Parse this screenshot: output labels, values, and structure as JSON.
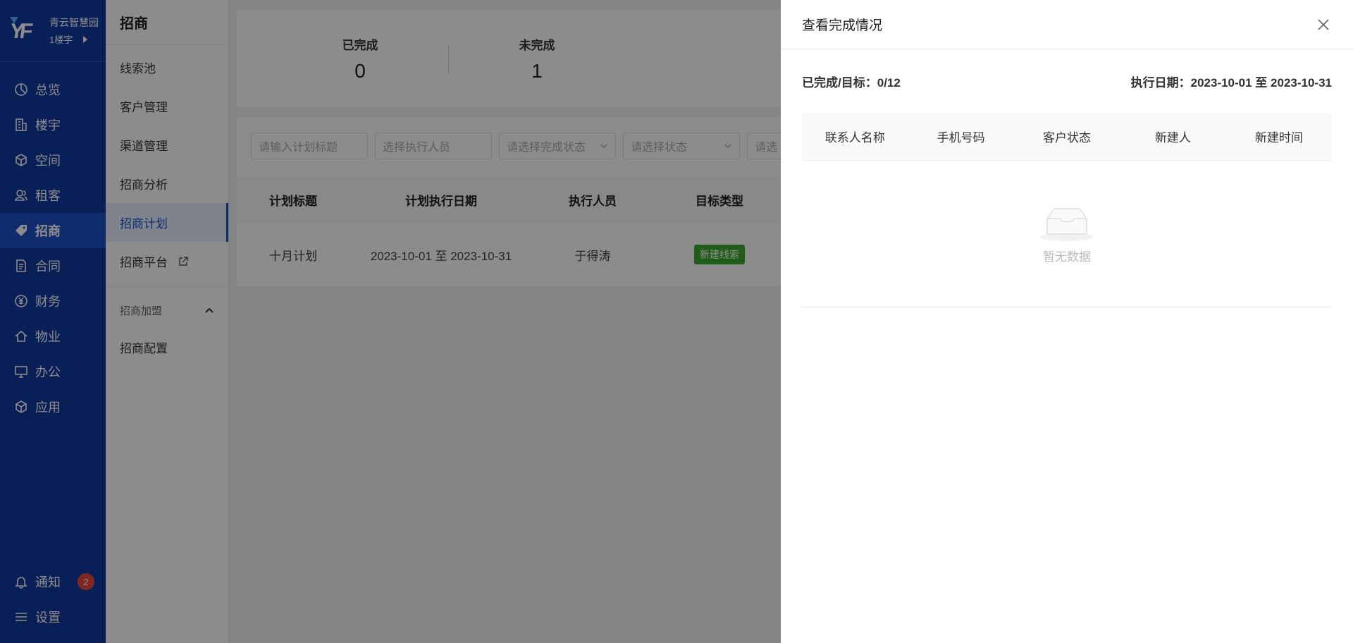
{
  "brand": {
    "name": "青云智慧园",
    "building": "1楼宇"
  },
  "nav": {
    "items": [
      {
        "label": "总览",
        "icon": "pie-chart-icon"
      },
      {
        "label": "楼宇",
        "icon": "building-icon"
      },
      {
        "label": "空间",
        "icon": "cube-icon"
      },
      {
        "label": "租客",
        "icon": "users-icon"
      },
      {
        "label": "招商",
        "icon": "tag-icon"
      },
      {
        "label": "合同",
        "icon": "document-icon"
      },
      {
        "label": "财务",
        "icon": "yen-circle-icon"
      },
      {
        "label": "物业",
        "icon": "home-icon"
      },
      {
        "label": "办公",
        "icon": "monitor-icon"
      },
      {
        "label": "应用",
        "icon": "app-cube-icon"
      }
    ],
    "notify": "通知",
    "notify_count": "2",
    "settings": "设置"
  },
  "submenu": {
    "title": "招商",
    "items": [
      "线索池",
      "客户管理",
      "渠道管理",
      "招商分析",
      "招商计划",
      "招商平台"
    ],
    "group": "招商加盟",
    "group_items": [
      "招商配置"
    ]
  },
  "stats": {
    "done_label": "已完成",
    "done_value": "0",
    "undone_label": "未完成",
    "undone_value": "1"
  },
  "filters": [
    "请输入计划标题",
    "选择执行人员",
    "请选择完成状态",
    "请选择状态",
    "请选"
  ],
  "table": {
    "headers": [
      "计划标题",
      "计划执行日期",
      "执行人员",
      "目标类型"
    ],
    "rows": [
      {
        "title": "十月计划",
        "date": "2023-10-01 至 2023-10-31",
        "executor": "于得涛",
        "type": "新建线索"
      }
    ]
  },
  "drawer": {
    "title": "查看完成情况",
    "progress_label": "已完成/目标：",
    "progress_value": "0/12",
    "date_label": "执行日期：",
    "date_value": "2023-10-01 至 2023-10-31",
    "columns": [
      "联系人名称",
      "手机号码",
      "客户状态",
      "新建人",
      "新建时间"
    ],
    "empty": "暂无数据"
  }
}
